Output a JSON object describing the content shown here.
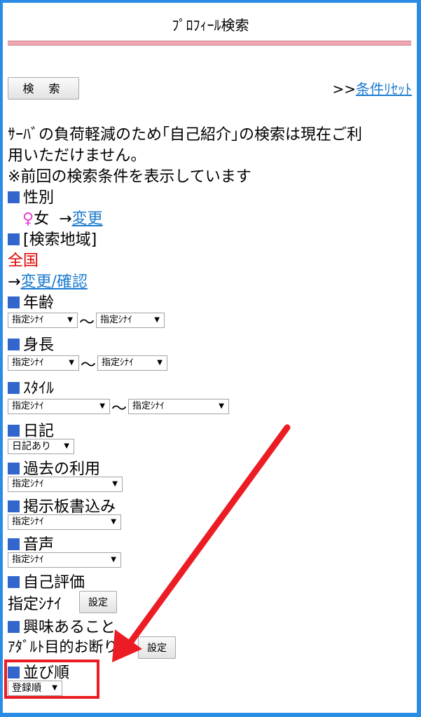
{
  "header": {
    "title": "ﾌﾟﾛﾌｨｰﾙ検索"
  },
  "toolbar": {
    "search_label": "検 索",
    "reset_prefix": ">>",
    "reset_link": "条件ﾘｾｯﾄ"
  },
  "notice": {
    "line1": "ｻｰﾊﾞの負荷軽減のため｢自己紹介｣の検索は現在ご利",
    "line2": "用いただけません。",
    "line3": "※前回の検索条件を表示しています"
  },
  "gender": {
    "label": "性別",
    "symbol": "♀",
    "value": "女",
    "arrow": "→",
    "change": "変更"
  },
  "region": {
    "label": "[検索地域]",
    "value": "全国",
    "arrow": "→",
    "change": "変更/確認"
  },
  "age": {
    "label": "年齢",
    "from": "指定ｼﾅｲ",
    "to": "指定ｼﾅｲ",
    "tilde": "〜"
  },
  "height": {
    "label": "身長",
    "from": "指定ｼﾅｲ",
    "to": "指定ｼﾅｲ",
    "tilde": "〜"
  },
  "style": {
    "label": "ｽﾀｲﾙ",
    "from": "指定ｼﾅｲ",
    "to": "指定ｼﾅｲ",
    "tilde": "〜"
  },
  "diary": {
    "label": "日記",
    "value": "日記あり"
  },
  "past_use": {
    "label": "過去の利用",
    "value": "指定ｼﾅｲ"
  },
  "board": {
    "label": "掲示板書込み",
    "value": "指定ｼﾅｲ"
  },
  "voice": {
    "label": "音声",
    "value": "指定ｼﾅｲ"
  },
  "self_eval": {
    "label": "自己評価",
    "value": "指定ｼﾅｲ",
    "button": "設定"
  },
  "interest": {
    "label": "興味あること",
    "value": "ｱﾀﾞﾙﾄ目的お断り",
    "button": "設定"
  },
  "sort": {
    "label": "並び順",
    "value": "登録順"
  },
  "icons": {
    "dropdown": "▼",
    "bullet": "■"
  },
  "colors": {
    "accent": "#3366cc",
    "link": "#1b7bd0",
    "annotation": "#ec1c24",
    "frame": "#2b8ce6"
  }
}
